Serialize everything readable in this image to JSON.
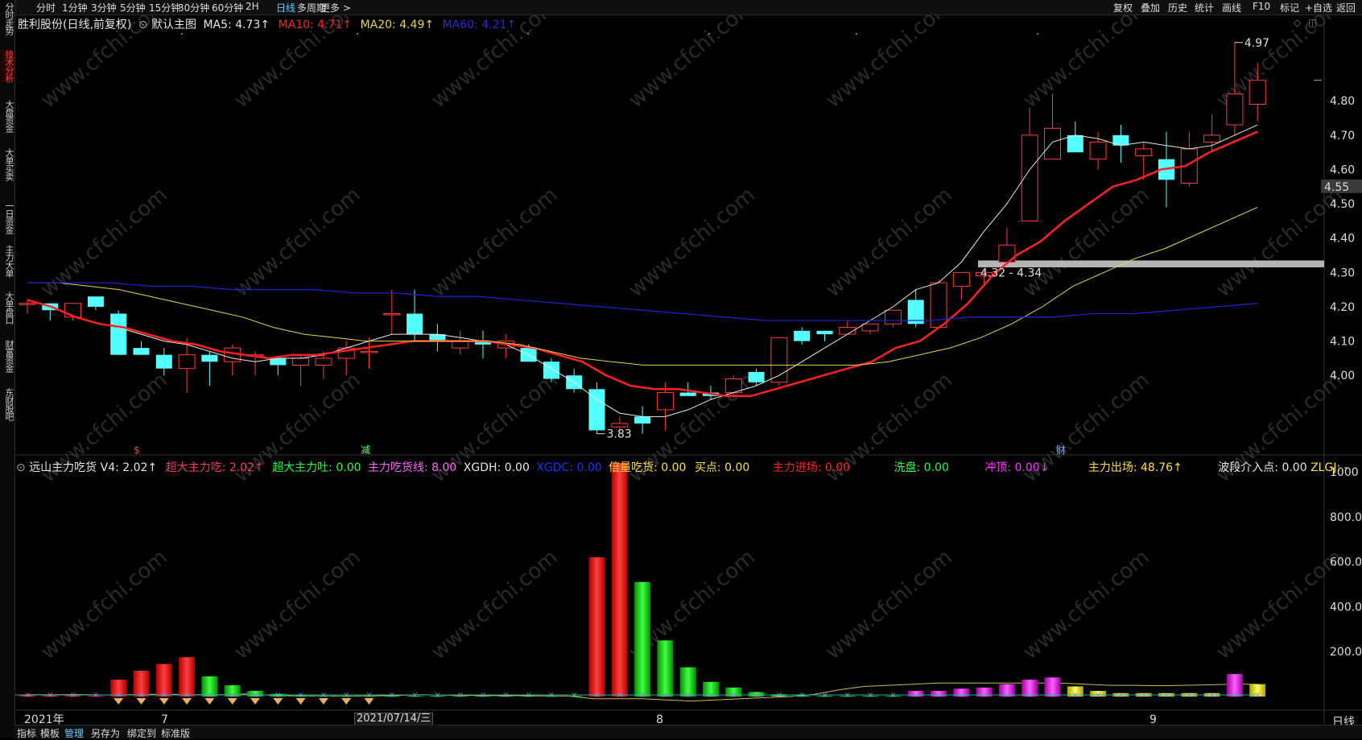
{
  "toolbar": {
    "timeframes": [
      "分时",
      "1分钟",
      "3分钟",
      "5分钟",
      "15分钟",
      "30分钟",
      "60分钟",
      "2H",
      "日线",
      "多周期",
      "更多 >"
    ],
    "active_timeframe": "日线",
    "right_buttons": [
      "复权",
      "叠加",
      "历史",
      "统计",
      "画线",
      "F10",
      "标记",
      "+自选",
      "返回"
    ]
  },
  "sidebar": {
    "items": [
      "分时走势",
      "技术分析",
      "大盘资金",
      "大单买卖",
      "一日资金",
      "主力大单",
      "大单盘口",
      "财富资金",
      "东财股吧"
    ],
    "active_item": "技术分析"
  },
  "main_legend": {
    "stock": "胜利股份(日线,前复权)",
    "chart_name": "默认主图",
    "ma5": "MA5: 4.73↑",
    "ma10": "MA10: 4.71↑",
    "ma20": "MA20: 4.49↑",
    "ma60": "MA60: 4.21↑"
  },
  "indicator_legend": {
    "name": "远山主力吃货",
    "v4": "V4: 2.02↑",
    "chao_da_chi": "超大主力吃: 2.02↑",
    "chao_da_tu": "超大主力吐: 0.00",
    "chi_huo_xian": "主力吃货线: 8.00",
    "xgdh": "XGDH: 0.00",
    "xgdc": "XGDC: 0.00",
    "bei_liang": "倍量吃货: 0.00",
    "mai_dian": "买点: 0.00",
    "jin_chang": "主力进场: 0.00",
    "xi_pan": "洗盘: 0.00",
    "chong_ding": "冲顶: 0.00↓",
    "chu_chang": "主力出场: 48.76↑",
    "bo_duan": "波段介入点: 0.00",
    "zlgj": "ZLGJ: -"
  },
  "price_axis": [
    "4.80",
    "4.70",
    "4.60",
    "4.50",
    "4.40",
    "4.30",
    "4.20",
    "4.10",
    "4.00"
  ],
  "current_price_tag": "4.55",
  "volume_axis": [
    "1000",
    "800.0",
    "600.0",
    "400.0",
    "200.0"
  ],
  "annotations": {
    "high": "4.97",
    "low": "3.83",
    "zone": "4.32 - 4.34",
    "date_tag": "2021/07/14/三"
  },
  "event_markers": [
    "$",
    "减",
    "财"
  ],
  "date_labels": [
    "2021年",
    "7",
    "8",
    "9"
  ],
  "axis_footer": "日线",
  "zoom_buttons": [
    "+",
    "−"
  ],
  "bottom_tabs": [
    "指标",
    "模板",
    "管理",
    "另存为",
    "绑定到",
    "标准版"
  ],
  "active_bottom_tab": "管理",
  "watermark": "www.cfchi.com",
  "colors": {
    "up": "#ff3b3b",
    "down": "#54ffff",
    "ma5": "#e8e8e8",
    "ma10": "#ff2020",
    "ma20": "#e6d840",
    "ma60": "#2020c8",
    "accent": "#5bc0ff"
  },
  "chart_data": {
    "type": "candlestick",
    "price_range": [
      3.78,
      5.0
    ],
    "candles": [
      [
        4.21,
        4.22,
        4.18,
        4.21
      ],
      [
        4.21,
        4.21,
        4.16,
        4.19
      ],
      [
        4.17,
        4.21,
        4.16,
        4.21
      ],
      [
        4.23,
        4.23,
        4.19,
        4.2
      ],
      [
        4.18,
        4.19,
        4.06,
        4.06
      ],
      [
        4.08,
        4.1,
        4.06,
        4.06
      ],
      [
        4.06,
        4.08,
        4.0,
        4.02
      ],
      [
        4.02,
        4.11,
        3.95,
        4.06
      ],
      [
        4.06,
        4.07,
        3.97,
        4.04
      ],
      [
        4.04,
        4.09,
        4.0,
        4.08
      ],
      [
        4.06,
        4.07,
        4.0,
        4.06
      ],
      [
        4.05,
        4.05,
        4.0,
        4.03
      ],
      [
        4.03,
        4.06,
        3.97,
        4.05
      ],
      [
        4.03,
        4.07,
        3.99,
        4.05
      ],
      [
        4.05,
        4.1,
        4.0,
        4.08
      ],
      [
        4.07,
        4.11,
        4.02,
        4.07
      ],
      [
        4.18,
        4.25,
        4.12,
        4.18
      ],
      [
        4.18,
        4.25,
        4.1,
        4.12
      ],
      [
        4.12,
        4.15,
        4.07,
        4.1
      ],
      [
        4.08,
        4.13,
        4.06,
        4.1
      ],
      [
        4.1,
        4.13,
        4.05,
        4.09
      ],
      [
        4.08,
        4.12,
        4.05,
        4.1
      ],
      [
        4.08,
        4.09,
        4.04,
        4.04
      ],
      [
        4.04,
        4.05,
        3.98,
        3.99
      ],
      [
        4.0,
        4.02,
        3.95,
        3.96
      ],
      [
        3.96,
        3.98,
        3.83,
        3.84
      ],
      [
        3.85,
        3.88,
        3.83,
        3.86
      ],
      [
        3.88,
        3.91,
        3.83,
        3.86
      ],
      [
        3.9,
        3.98,
        3.84,
        3.95
      ],
      [
        3.95,
        3.98,
        3.94,
        3.94
      ],
      [
        3.95,
        3.97,
        3.93,
        3.94
      ],
      [
        3.95,
        4.0,
        3.94,
        3.99
      ],
      [
        4.01,
        4.02,
        3.97,
        3.98
      ],
      [
        3.98,
        4.11,
        3.97,
        4.11
      ],
      [
        4.13,
        4.14,
        4.09,
        4.1
      ],
      [
        4.13,
        4.13,
        4.1,
        4.12
      ],
      [
        4.12,
        4.16,
        4.12,
        4.14
      ],
      [
        4.13,
        4.15,
        4.12,
        4.15
      ],
      [
        4.15,
        4.19,
        4.14,
        4.19
      ],
      [
        4.22,
        4.25,
        4.14,
        4.15
      ],
      [
        4.14,
        4.28,
        4.14,
        4.27
      ],
      [
        4.26,
        4.3,
        4.22,
        4.3
      ],
      [
        4.29,
        4.31,
        4.26,
        4.3
      ],
      [
        4.33,
        4.43,
        4.33,
        4.38
      ],
      [
        4.45,
        4.78,
        4.45,
        4.7
      ],
      [
        4.63,
        4.82,
        4.63,
        4.72
      ],
      [
        4.7,
        4.74,
        4.65,
        4.65
      ],
      [
        4.63,
        4.71,
        4.6,
        4.68
      ],
      [
        4.7,
        4.73,
        4.62,
        4.67
      ],
      [
        4.64,
        4.68,
        4.57,
        4.66
      ],
      [
        4.63,
        4.71,
        4.49,
        4.57
      ],
      [
        4.56,
        4.71,
        4.55,
        4.66
      ],
      [
        4.68,
        4.76,
        4.65,
        4.7
      ],
      [
        4.73,
        4.97,
        4.7,
        4.82
      ],
      [
        4.79,
        4.91,
        4.74,
        4.86
      ]
    ],
    "volume": [
      {
        "value": 6,
        "color": "red"
      },
      {
        "value": 5,
        "color": "red"
      },
      {
        "value": 5,
        "color": "red"
      },
      {
        "value": 4,
        "color": "red"
      },
      {
        "value": 75,
        "color": "red"
      },
      {
        "value": 115,
        "color": "red"
      },
      {
        "value": 145,
        "color": "red"
      },
      {
        "value": 175,
        "color": "red"
      },
      {
        "value": 90,
        "color": "green"
      },
      {
        "value": 50,
        "color": "green"
      },
      {
        "value": 25,
        "color": "green"
      },
      {
        "value": 12,
        "color": "green"
      },
      {
        "value": 6,
        "color": "green"
      },
      {
        "value": 4,
        "color": "green"
      },
      {
        "value": 3,
        "color": "green"
      },
      {
        "value": 3,
        "color": "green"
      },
      {
        "value": 3,
        "color": "green"
      },
      {
        "value": 3,
        "color": "green"
      },
      {
        "value": 3,
        "color": "green"
      },
      {
        "value": 3,
        "color": "green"
      },
      {
        "value": 3,
        "color": "green"
      },
      {
        "value": 3,
        "color": "green"
      },
      {
        "value": 3,
        "color": "green"
      },
      {
        "value": 3,
        "color": "green"
      },
      {
        "value": 3,
        "color": "green"
      },
      {
        "value": 620,
        "color": "red"
      },
      {
        "value": 1040,
        "color": "red"
      },
      {
        "value": 510,
        "color": "green"
      },
      {
        "value": 250,
        "color": "green"
      },
      {
        "value": 130,
        "color": "green"
      },
      {
        "value": 65,
        "color": "green"
      },
      {
        "value": 40,
        "color": "green"
      },
      {
        "value": 20,
        "color": "green"
      },
      {
        "value": 10,
        "color": "green"
      },
      {
        "value": 4,
        "color": "green"
      },
      {
        "value": 3,
        "color": "green"
      },
      {
        "value": 3,
        "color": "green"
      },
      {
        "value": 3,
        "color": "green"
      },
      {
        "value": 3,
        "color": "green"
      },
      {
        "value": 25,
        "color": "magenta"
      },
      {
        "value": 25,
        "color": "magenta"
      },
      {
        "value": 35,
        "color": "magenta"
      },
      {
        "value": 40,
        "color": "magenta"
      },
      {
        "value": 55,
        "color": "magenta"
      },
      {
        "value": 75,
        "color": "magenta"
      },
      {
        "value": 85,
        "color": "magenta"
      },
      {
        "value": 45,
        "color": "yellow"
      },
      {
        "value": 25,
        "color": "yellow"
      },
      {
        "value": 15,
        "color": "yellow"
      },
      {
        "value": 15,
        "color": "yellow"
      },
      {
        "value": 15,
        "color": "yellow"
      },
      {
        "value": 15,
        "color": "yellow"
      },
      {
        "value": 15,
        "color": "yellow"
      },
      {
        "value": 100,
        "color": "magenta"
      },
      {
        "value": 55,
        "color": "yellow"
      }
    ],
    "volume_range": [
      0,
      1040
    ],
    "ma_series": [
      {
        "name": "MA5",
        "color": "#e8e8e8",
        "width": 1,
        "start": 4,
        "values": [
          4.14,
          4.12,
          4.1,
          4.09,
          4.07,
          4.05,
          4.04,
          4.05,
          4.05,
          4.06,
          4.08,
          4.1,
          4.12,
          4.12,
          4.12,
          4.11,
          4.1,
          4.09,
          4.06,
          4.02,
          3.98,
          3.93,
          3.89,
          3.88,
          3.88,
          3.9,
          3.93,
          3.95,
          3.97,
          4.0,
          4.04,
          4.08,
          4.12,
          4.16,
          4.2,
          4.25,
          4.27,
          4.33,
          4.42,
          4.5,
          4.6,
          4.68,
          4.7,
          4.69,
          4.67,
          4.68,
          4.67,
          4.66,
          4.67,
          4.7,
          4.73
        ]
      },
      {
        "name": "MA10",
        "color": "#ff2020",
        "width": 2.5,
        "start": 0,
        "values": [
          4.22,
          4.2,
          4.17,
          4.15,
          4.14,
          4.12,
          4.1,
          4.09,
          4.07,
          4.06,
          4.05,
          4.06,
          4.06,
          4.07,
          4.08,
          4.09,
          4.1,
          4.1,
          4.1,
          4.1,
          4.09,
          4.08,
          4.06,
          4.04,
          4.0,
          3.97,
          3.96,
          3.96,
          3.95,
          3.94,
          3.94,
          3.96,
          3.98,
          4.0,
          4.02,
          4.04,
          4.08,
          4.1,
          4.15,
          4.21,
          4.29,
          4.35,
          4.39,
          4.45,
          4.5,
          4.55,
          4.57,
          4.6,
          4.61,
          4.65,
          4.68,
          4.71
        ]
      },
      {
        "name": "MA20",
        "color": "#e6d840",
        "width": 1,
        "start": 0,
        "values": [
          4.27,
          4.27,
          4.26,
          4.25,
          4.23,
          4.21,
          4.19,
          4.17,
          4.14,
          4.12,
          4.11,
          4.1,
          4.1,
          4.1,
          4.1,
          4.1,
          4.09,
          4.07,
          4.05,
          4.04,
          4.03,
          4.03,
          4.03,
          4.03,
          4.03,
          4.03,
          4.03,
          4.03,
          4.04,
          4.06,
          4.08,
          4.11,
          4.15,
          4.2,
          4.26,
          4.3,
          4.34,
          4.37,
          4.41,
          4.45,
          4.49
        ]
      },
      {
        "name": "MA60",
        "color": "#2020c8",
        "width": 1.3,
        "start": 0,
        "values": [
          4.27,
          4.27,
          4.27,
          4.26,
          4.26,
          4.25,
          4.25,
          4.25,
          4.24,
          4.24,
          4.23,
          4.23,
          4.22,
          4.21,
          4.2,
          4.19,
          4.18,
          4.17,
          4.16,
          4.16,
          4.16,
          4.16,
          4.16,
          4.17,
          4.17,
          4.17,
          4.18,
          4.18,
          4.19,
          4.2,
          4.21
        ]
      },
      {
        "name": "ind-yellow",
        "panel": "volume",
        "color": "#c8c040",
        "width": 1,
        "start": 0,
        "values": [
          8,
          8,
          9,
          7,
          8,
          10,
          10,
          8,
          8,
          12,
          5,
          3,
          2,
          2,
          3,
          5,
          8,
          6,
          5,
          4,
          4,
          3,
          2,
          -10,
          -10,
          -10,
          -15,
          -20,
          -15,
          -10,
          -5,
          0,
          10,
          30,
          45,
          50,
          55,
          60,
          60,
          60,
          60,
          60,
          60,
          55,
          50,
          50,
          48,
          50,
          52,
          55,
          55
        ]
      }
    ]
  }
}
